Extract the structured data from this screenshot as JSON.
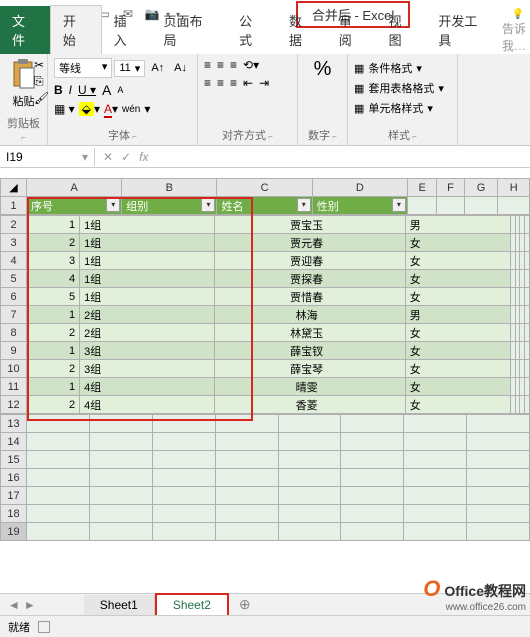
{
  "title": "合并后 - Excel",
  "tabs": {
    "file": "文件",
    "home": "开始",
    "insert": "插入",
    "layout": "页面布局",
    "formulas": "公式",
    "data": "数据",
    "review": "审阅",
    "view": "视图",
    "dev": "开发工具"
  },
  "tell_me": "告诉我…",
  "ribbon": {
    "clipboard": {
      "paste": "粘贴",
      "label": "剪贴板"
    },
    "font": {
      "name": "等线",
      "size": "11",
      "label": "字体",
      "bold": "B",
      "italic": "I",
      "underline": "U",
      "phonetic": "wén"
    },
    "align": {
      "label": "对齐方式"
    },
    "number": {
      "percent": "%",
      "label": "数字"
    },
    "styles": {
      "cond": "条件格式",
      "table": "套用表格格式",
      "cell": "单元格样式",
      "label": "样式"
    }
  },
  "namebox": "I19",
  "fx": "fx",
  "columns": [
    "A",
    "B",
    "C",
    "D",
    "E",
    "F",
    "G",
    "H"
  ],
  "table_headers": [
    "序号",
    "组别",
    "姓名",
    "性别"
  ],
  "table_rows": [
    {
      "seq": "1",
      "group": "1组",
      "name": "贾宝玉",
      "gender": "男"
    },
    {
      "seq": "2",
      "group": "1组",
      "name": "贾元春",
      "gender": "女"
    },
    {
      "seq": "3",
      "group": "1组",
      "name": "贾迎春",
      "gender": "女"
    },
    {
      "seq": "4",
      "group": "1组",
      "name": "贾探春",
      "gender": "女"
    },
    {
      "seq": "5",
      "group": "1组",
      "name": "贾惜春",
      "gender": "女"
    },
    {
      "seq": "1",
      "group": "2组",
      "name": "林海",
      "gender": "男"
    },
    {
      "seq": "2",
      "group": "2组",
      "name": "林黛玉",
      "gender": "女"
    },
    {
      "seq": "1",
      "group": "3组",
      "name": "薛宝钗",
      "gender": "女"
    },
    {
      "seq": "2",
      "group": "3组",
      "name": "薛宝琴",
      "gender": "女"
    },
    {
      "seq": "1",
      "group": "4组",
      "name": "晴雯",
      "gender": "女"
    },
    {
      "seq": "2",
      "group": "4组",
      "name": "香菱",
      "gender": "女"
    }
  ],
  "sheets": {
    "s1": "Sheet1",
    "s2": "Sheet2"
  },
  "status": "就绪",
  "watermark": {
    "brand": "Office教程网",
    "url": "www.office26.com"
  }
}
